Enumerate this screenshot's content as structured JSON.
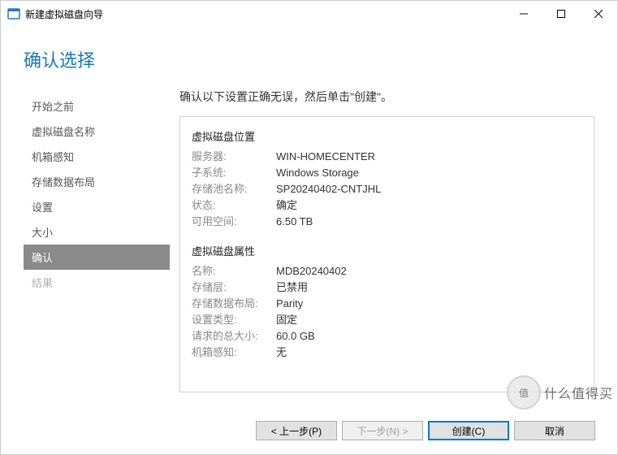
{
  "window": {
    "title": "新建虚拟磁盘向导"
  },
  "header": {
    "title": "确认选择"
  },
  "sidebar": {
    "items": [
      {
        "label": "开始之前"
      },
      {
        "label": "虚拟磁盘名称"
      },
      {
        "label": "机箱感知"
      },
      {
        "label": "存储数据布局"
      },
      {
        "label": "设置"
      },
      {
        "label": "大小"
      },
      {
        "label": "确认"
      },
      {
        "label": "结果"
      }
    ]
  },
  "main": {
    "intro": "确认以下设置正确无误，然后单击\"创建\"。",
    "section1_title": "虚拟磁盘位置",
    "section2_title": "虚拟磁盘属性",
    "location": {
      "server_label": "服务器:",
      "server_value": "WIN-HOMECENTER",
      "subsystem_label": "子系统:",
      "subsystem_value": "Windows Storage",
      "pool_label": "存储池名称:",
      "pool_value": "SP20240402-CNTJHL",
      "status_label": "状态:",
      "status_value": "确定",
      "free_label": "可用空间:",
      "free_value": "6.50 TB"
    },
    "properties": {
      "name_label": "名称:",
      "name_value": "MDB20240402",
      "tier_label": "存储层:",
      "tier_value": "已禁用",
      "layout_label": "存储数据布局:",
      "layout_value": "Parity",
      "provisioning_label": "设置类型:",
      "provisioning_value": "固定",
      "size_label": "请求的总大小:",
      "size_value": "60.0 GB",
      "enclosure_label": "机箱感知:",
      "enclosure_value": "无"
    }
  },
  "footer": {
    "previous": "< 上一步(P)",
    "next": "下一步(N) >",
    "create": "创建(C)",
    "cancel": "取消"
  },
  "watermark": {
    "circle": "值",
    "text": "什么值得买"
  }
}
